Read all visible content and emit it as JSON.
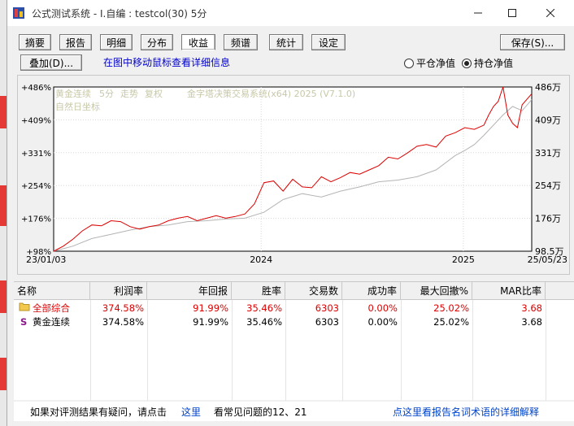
{
  "window": {
    "title": "公式测试系统 - I.自编 : testcol(30) 5分"
  },
  "tabs": [
    {
      "label": "摘要",
      "active": false
    },
    {
      "label": "报告",
      "active": false
    },
    {
      "label": "明细",
      "active": false
    },
    {
      "label": "分布",
      "active": false
    },
    {
      "label": "收益",
      "active": true
    },
    {
      "label": "频谱",
      "active": false
    },
    {
      "label": "统计",
      "active": false
    },
    {
      "label": "设定",
      "active": false
    }
  ],
  "toolbar": {
    "save_label": "保存(S)...",
    "overlay_label": "叠加(D)...",
    "hint": "在图中移动鼠标查看详细信息"
  },
  "radios": [
    {
      "label": "平仓净值",
      "checked": false
    },
    {
      "label": "持仓净值",
      "checked": true
    }
  ],
  "chart_legend": {
    "instrument": "黄金连续",
    "period": "5分",
    "mode1": "走势",
    "mode2": "复权",
    "system": "金字塔决策交易系统(x64) 2025 (V7.1.0)",
    "coord": "自然日坐标"
  },
  "chart_data": {
    "type": "line",
    "x_tick_labels": [
      "23/01/03",
      "2024",
      "2025",
      "25/05/23"
    ],
    "y_left_ticks": [
      "+486%",
      "+409%",
      "+331%",
      "+254%",
      "+176%",
      "+98%"
    ],
    "y_right_ticks": [
      "486万",
      "409万",
      "331万",
      "254万",
      "176万",
      "98.5万"
    ],
    "ylim": [
      98,
      486
    ],
    "colors": {
      "equity": "#dd0000",
      "price": "#b4b4b4"
    },
    "series": [
      {
        "name_visible": false,
        "role": "equity",
        "x": [
          0,
          0.02,
          0.04,
          0.06,
          0.08,
          0.1,
          0.12,
          0.14,
          0.16,
          0.18,
          0.2,
          0.22,
          0.24,
          0.26,
          0.28,
          0.3,
          0.32,
          0.34,
          0.36,
          0.38,
          0.4,
          0.42,
          0.44,
          0.46,
          0.48,
          0.5,
          0.52,
          0.54,
          0.56,
          0.58,
          0.6,
          0.62,
          0.64,
          0.66,
          0.68,
          0.7,
          0.72,
          0.74,
          0.76,
          0.78,
          0.8,
          0.82,
          0.84,
          0.86,
          0.88,
          0.9,
          0.91,
          0.92,
          0.93,
          0.94,
          0.95,
          0.96,
          0.97,
          0.98,
          1.0
        ],
        "values": [
          98,
          110,
          126,
          146,
          160,
          158,
          170,
          168,
          156,
          150,
          156,
          160,
          170,
          176,
          180,
          170,
          176,
          182,
          176,
          180,
          186,
          210,
          260,
          264,
          240,
          268,
          250,
          248,
          274,
          262,
          272,
          284,
          280,
          290,
          300,
          320,
          316,
          330,
          346,
          350,
          344,
          370,
          378,
          390,
          386,
          396,
          420,
          440,
          452,
          486,
          420,
          400,
          390,
          444,
          470
        ]
      },
      {
        "name_visible": false,
        "role": "price",
        "x": [
          0,
          0.04,
          0.08,
          0.12,
          0.16,
          0.2,
          0.24,
          0.28,
          0.32,
          0.36,
          0.4,
          0.44,
          0.48,
          0.52,
          0.56,
          0.6,
          0.64,
          0.68,
          0.72,
          0.76,
          0.8,
          0.84,
          0.86,
          0.88,
          0.9,
          0.92,
          0.94,
          0.96,
          0.98,
          1.0
        ],
        "values": [
          98,
          110,
          128,
          138,
          148,
          156,
          160,
          168,
          170,
          174,
          176,
          190,
          220,
          234,
          226,
          240,
          250,
          262,
          266,
          274,
          290,
          324,
          336,
          350,
          372,
          396,
          420,
          440,
          430,
          456
        ]
      }
    ]
  },
  "table": {
    "headers": [
      "名称",
      "利润率",
      "年回报",
      "胜率",
      "交易数",
      "成功率",
      "最大回撤%",
      "MAR比率"
    ],
    "rows": [
      {
        "icon": "folder-icon",
        "name": "全部综合",
        "profit": "374.58%",
        "annual": "91.99%",
        "win": "35.46%",
        "trades": "6303",
        "success": "0.00%",
        "drawdown": "25.02%",
        "mar": "3.68",
        "color": "#dd0000"
      },
      {
        "icon": "S",
        "name": "黄金连续",
        "profit": "374.58%",
        "annual": "91.99%",
        "win": "35.46%",
        "trades": "6303",
        "success": "0.00%",
        "drawdown": "25.02%",
        "mar": "3.68",
        "color": "#000000"
      }
    ]
  },
  "footer": {
    "question": "如果对评测结果有疑问，请点击",
    "here": "这里",
    "faq": "看常见问题的12、21",
    "glossary": "点这里看报告名词术语的详细解释"
  }
}
